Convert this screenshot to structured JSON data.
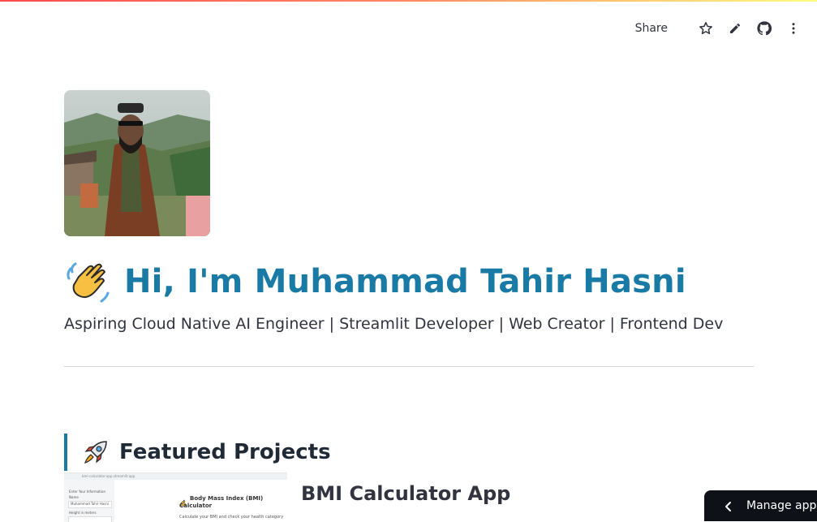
{
  "toolbar": {
    "share_label": "Share",
    "icons": [
      "star-icon",
      "pencil-icon",
      "github-icon",
      "more-vertical-icon"
    ]
  },
  "profile": {
    "greeting_icon": "waving-hand-icon",
    "title": "Hi, I'm Muhammad Tahir Hasni",
    "subtitle": "Aspiring Cloud Native AI Engineer | Streamlit Developer | Web Creator | Frontend Dev"
  },
  "projects": {
    "section_icon": "rocket-icon",
    "heading": "Featured Projects",
    "items": [
      {
        "title": "BMI Calculator App",
        "thumbnail": {
          "address": "bmi-calculator-app.streamlit.app",
          "sidebar_heading": "Enter Your Information",
          "name_label": "Name",
          "name_value": "Muhammad Tahir Hasni",
          "height_label": "Height in meters",
          "app_title_line1": "Body Mass Index (BMI)",
          "app_title_line2": "Calculator",
          "app_subtitle": "Calculate your BMI and check your health category"
        }
      }
    ]
  },
  "manage": {
    "label": "Manage app"
  },
  "colors": {
    "accent": "#1a7aa6",
    "dark": "#0e1117",
    "text": "#31333f"
  }
}
